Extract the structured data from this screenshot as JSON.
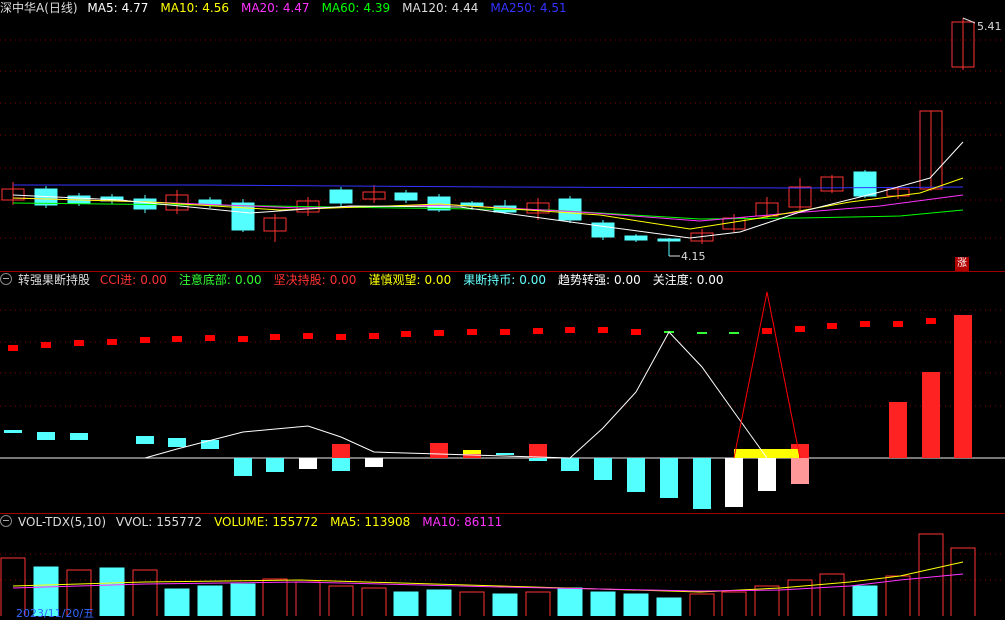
{
  "main_chart": {
    "title": "深中华A(日线)",
    "indicators": [
      {
        "label": "MA5:",
        "value": "4.77",
        "color": "#ffffff"
      },
      {
        "label": "MA10:",
        "value": "4.56",
        "color": "#ffff00"
      },
      {
        "label": "MA20:",
        "value": "4.47",
        "color": "#ff33ff"
      },
      {
        "label": "MA60:",
        "value": "4.39",
        "color": "#00ff00"
      },
      {
        "label": "MA120:",
        "value": "4.44",
        "color": "#dddddd"
      },
      {
        "label": "MA250:",
        "value": "4.51",
        "color": "#3333ff"
      }
    ],
    "high_label": "5.41",
    "low_label": "4.15",
    "limit_badge": "涨"
  },
  "signal_panel": {
    "title": "转强果断持股",
    "items": [
      {
        "label": "CCI进:",
        "value": "0.00",
        "color": "#ff3333"
      },
      {
        "label": "注意底部:",
        "value": "0.00",
        "color": "#33ff33"
      },
      {
        "label": "坚决持股:",
        "value": "0.00",
        "color": "#ff3333"
      },
      {
        "label": "谨慎观望:",
        "value": "0.00",
        "color": "#ffff00"
      },
      {
        "label": "果断持币:",
        "value": "0.00",
        "color": "#66ffff"
      },
      {
        "label": "趋势转强:",
        "value": "0.00",
        "color": "#ffffff"
      },
      {
        "label": "关注度:",
        "value": "0.00",
        "color": "#ffffff"
      }
    ]
  },
  "volume_panel": {
    "title": "VOL-TDX(5,10)",
    "items": [
      {
        "label": "VVOL:",
        "value": "155772",
        "color": "#dddddd"
      },
      {
        "label": "VOLUME:",
        "value": "155772",
        "color": "#ffff00"
      },
      {
        "label": "MA5:",
        "value": "113908",
        "color": "#ffff00"
      },
      {
        "label": "MA10:",
        "value": "86111",
        "color": "#ff33ff"
      }
    ],
    "date_label": "2023/11/20/五"
  },
  "colors": {
    "up": "#ff3232",
    "down": "#54ffff",
    "grid": "#800000",
    "ma5": "#ffffff",
    "ma10": "#ffff00",
    "ma20": "#ff33ff",
    "ma60": "#00ff00",
    "ma250": "#3333ff"
  }
}
